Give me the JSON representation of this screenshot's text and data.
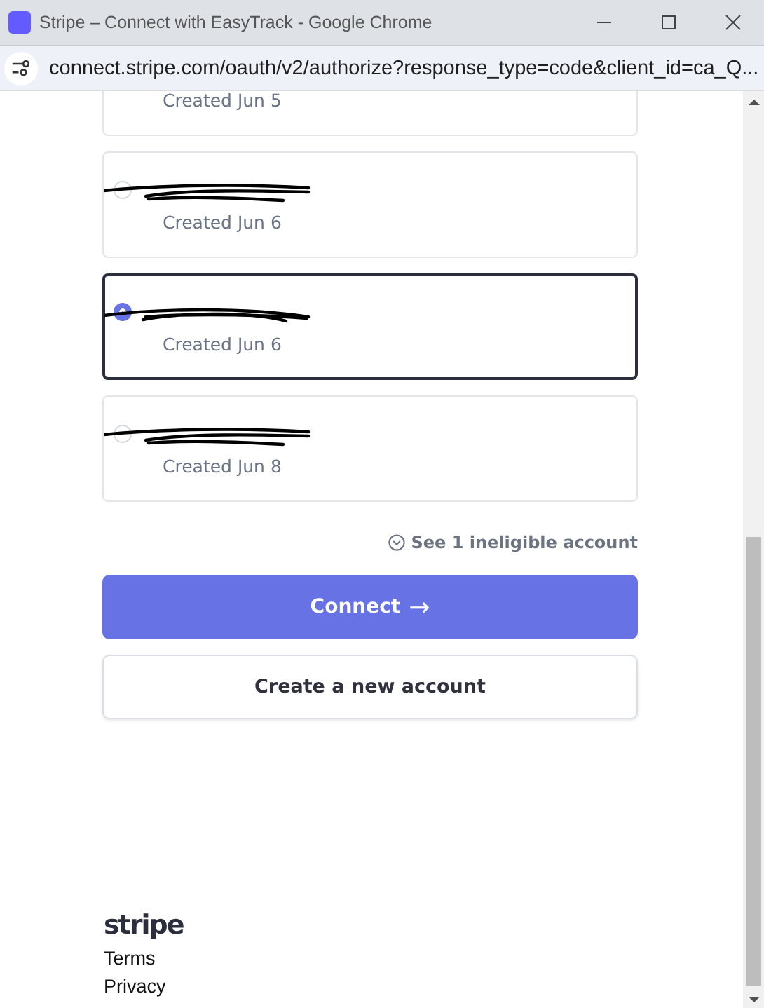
{
  "window": {
    "title": "Stripe – Connect with EasyTrack - Google Chrome"
  },
  "address_bar": {
    "url": "connect.stripe.com/oauth/v2/authorize?response_type=code&client_id=ca_Q..."
  },
  "accounts": [
    {
      "created": "Created Jun 5"
    },
    {
      "redacted": true,
      "created": "Created Jun 6",
      "selected": false
    },
    {
      "redacted": true,
      "created": "Created Jun 6",
      "selected": true
    },
    {
      "redacted": true,
      "created": "Created Jun 8",
      "selected": false
    }
  ],
  "ineligible_link": "See 1 ineligible account",
  "connect_button": {
    "label": "Connect",
    "arrow": "→"
  },
  "create_button": "Create a new account",
  "footer": {
    "logo": "stripe",
    "links": [
      "Terms",
      "Privacy"
    ]
  }
}
